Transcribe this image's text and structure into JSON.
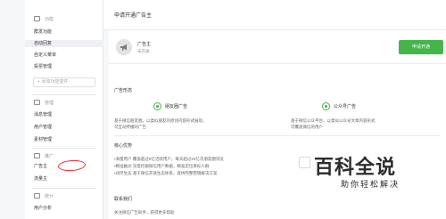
{
  "sidebar": {
    "function_section": {
      "label": "功能"
    },
    "function_items": [
      "群发功能",
      "自动回复",
      "自定义菜单",
      "投票管理"
    ],
    "add_plugin": "+ 添加功能插件",
    "management_section": {
      "label": "管理"
    },
    "management_items": [
      "消息管理",
      "用户管理",
      "素材管理"
    ],
    "promotion_section": {
      "label": "推广"
    },
    "promotion_items": [
      "广告主",
      "流量主"
    ],
    "stats_section": {
      "label": "统计"
    },
    "stats_items": [
      "用户分析"
    ]
  },
  "main": {
    "title": "申请开通广告主",
    "advertiser": {
      "name": "广告主",
      "status": "未开通",
      "apply_label": "申请开通"
    },
    "ad_format": {
      "heading": "广告形态",
      "platforms": [
        {
          "name": "朋友圈广告",
          "desc_1": "基于微信朋友圈，以类似朋友的原创内容形式展现，",
          "desc_2": "可互动传播的广告"
        },
        {
          "name": "公众号广告",
          "desc_1": "基于微信公众平台，以类似公众号文章内容形式",
          "desc_2": "可覆盖微信的用户"
        }
      ]
    },
    "core_advantages": {
      "heading": "核心优势",
      "lines": [
        "•海量用户 覆盖超过8亿活跃用户，每天超过20亿次朋友圈浏览",
        "•精准触达 深度挖掘微信用户数据，精准定位目标人群",
        "•闭环生态 基于微信开放生态体系，提供完整营销解决方案"
      ]
    },
    "contact": {
      "heading": "联系我们",
      "line": "关注微信广告助手，获得更多帮助"
    },
    "colors": {
      "accent": "#44b549",
      "highlight_ring": "#e4312f"
    },
    "watermark": {
      "main": "百科全说",
      "sub": "助你轻松解决"
    }
  }
}
